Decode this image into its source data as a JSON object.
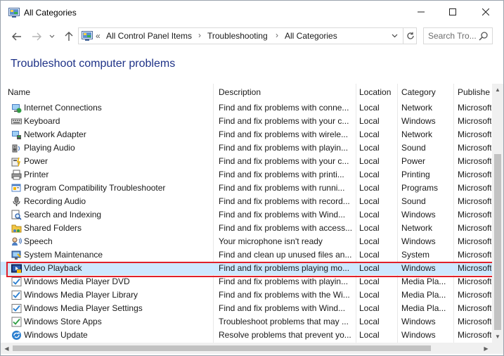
{
  "window": {
    "title": "All Categories",
    "icon": "control-panel-icon"
  },
  "titlebar_buttons": [
    "minimize",
    "maximize",
    "close"
  ],
  "address": {
    "prefix": "«",
    "breadcrumbs": [
      "All Control Panel Items",
      "Troubleshooting",
      "All Categories"
    ],
    "separator": "›"
  },
  "search": {
    "placeholder": "Search Tro..."
  },
  "heading": "Troubleshoot computer problems",
  "columns": [
    "Name",
    "Description",
    "Location",
    "Category",
    "Publishe"
  ],
  "rows": [
    {
      "name": "Internet Connections",
      "desc": "Find and fix problems with conne...",
      "loc": "Local",
      "cat": "Network",
      "pub": "Microsoft",
      "icon": "network-globe-icon"
    },
    {
      "name": "Keyboard",
      "desc": "Find and fix problems with your c...",
      "loc": "Local",
      "cat": "Windows",
      "pub": "Microsoft",
      "icon": "keyboard-icon"
    },
    {
      "name": "Network Adapter",
      "desc": "Find and fix problems with wirele...",
      "loc": "Local",
      "cat": "Network",
      "pub": "Microsoft",
      "icon": "network-adapter-icon"
    },
    {
      "name": "Playing Audio",
      "desc": "Find and fix problems with playin...",
      "loc": "Local",
      "cat": "Sound",
      "pub": "Microsoft",
      "icon": "speaker-icon"
    },
    {
      "name": "Power",
      "desc": "Find and fix problems with your c...",
      "loc": "Local",
      "cat": "Power",
      "pub": "Microsoft",
      "icon": "power-icon"
    },
    {
      "name": "Printer",
      "desc": "Find and fix problems with printi...",
      "loc": "Local",
      "cat": "Printing",
      "pub": "Microsoft",
      "icon": "printer-icon"
    },
    {
      "name": "Program Compatibility Troubleshooter",
      "desc": "Find and fix problems with runni...",
      "loc": "Local",
      "cat": "Programs",
      "pub": "Microsoft",
      "icon": "program-compat-icon"
    },
    {
      "name": "Recording Audio",
      "desc": "Find and fix problems with record...",
      "loc": "Local",
      "cat": "Sound",
      "pub": "Microsoft",
      "icon": "microphone-icon"
    },
    {
      "name": "Search and Indexing",
      "desc": "Find and fix problems with Wind...",
      "loc": "Local",
      "cat": "Windows",
      "pub": "Microsoft",
      "icon": "search-index-icon"
    },
    {
      "name": "Shared Folders",
      "desc": "Find and fix problems with access...",
      "loc": "Local",
      "cat": "Network",
      "pub": "Microsoft",
      "icon": "shared-folder-icon"
    },
    {
      "name": "Speech",
      "desc": "Your microphone isn't ready",
      "loc": "Local",
      "cat": "Windows",
      "pub": "Microsoft",
      "icon": "speech-icon"
    },
    {
      "name": "System Maintenance",
      "desc": "Find and clean up unused files an...",
      "loc": "Local",
      "cat": "System",
      "pub": "Microsoft",
      "icon": "system-maintenance-icon"
    },
    {
      "name": "Video Playback",
      "desc": "Find and fix problems playing mo...",
      "loc": "Local",
      "cat": "Windows",
      "pub": "Microsoft",
      "icon": "video-playback-icon",
      "highlighted": true
    },
    {
      "name": "Windows Media Player DVD",
      "desc": "Find and fix problems with playin...",
      "loc": "Local",
      "cat": "Media Pla...",
      "pub": "Microsoft",
      "icon": "media-player-icon"
    },
    {
      "name": "Windows Media Player Library",
      "desc": "Find and fix problems with the Wi...",
      "loc": "Local",
      "cat": "Media Pla...",
      "pub": "Microsoft",
      "icon": "media-player-icon"
    },
    {
      "name": "Windows Media Player Settings",
      "desc": "Find and fix problems with Wind...",
      "loc": "Local",
      "cat": "Media Pla...",
      "pub": "Microsoft",
      "icon": "media-player-icon"
    },
    {
      "name": "Windows Store Apps",
      "desc": "Troubleshoot problems that may ...",
      "loc": "Local",
      "cat": "Windows",
      "pub": "Microsoft",
      "icon": "store-apps-icon"
    },
    {
      "name": "Windows Update",
      "desc": "Resolve problems that prevent yo...",
      "loc": "Local",
      "cat": "Windows",
      "pub": "Microsoft",
      "icon": "windows-update-icon"
    }
  ],
  "colors": {
    "heading": "#1e3287",
    "selection": "#cde8ff",
    "highlight_border": "#e0202a"
  }
}
